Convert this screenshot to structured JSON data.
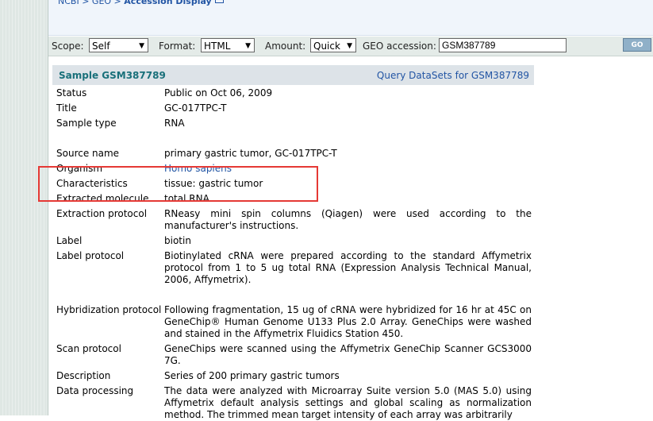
{
  "breadcrumb": {
    "part1": "NCBI",
    "sep1": " > ",
    "part2": "GEO",
    "sep2": " > ",
    "current": "Accession Display"
  },
  "toolbar": {
    "scope_label": "Scope:",
    "scope_value": "Self",
    "format_label": "Format:",
    "format_value": "HTML",
    "amount_label": "Amount:",
    "amount_value": "Quick",
    "accession_label": "GEO accession:",
    "accession_value": "GSM387789",
    "go_label": "GO"
  },
  "sample": {
    "title": "Sample GSM387789",
    "query_link": "Query DataSets for GSM387789"
  },
  "fields": {
    "status": {
      "label": "Status",
      "value": "Public on Oct 06, 2009"
    },
    "title": {
      "label": "Title",
      "value": "GC-017TPC-T"
    },
    "sample_type": {
      "label": "Sample type",
      "value": "RNA"
    },
    "source_name": {
      "label": "Source name",
      "value": "primary gastric tumor, GC-017TPC-T"
    },
    "organism": {
      "label": "Organism",
      "value": "Homo sapiens"
    },
    "characteristics": {
      "label": "Characteristics",
      "value": "tissue: gastric tumor"
    },
    "extracted_molecule": {
      "label": "Extracted molecule",
      "value": "total RNA"
    },
    "extraction_protocol": {
      "label": "Extraction protocol",
      "value": "RNeasy mini spin columns (Qiagen) were used according to the manufacturer's instructions."
    },
    "label": {
      "label": "Label",
      "value": "biotin"
    },
    "label_protocol": {
      "label": "Label protocol",
      "value": "Biotinylated cRNA were prepared according to the standard Affymetrix protocol from 1 to 5 ug total RNA (Expression Analysis Technical Manual, 2006, Affymetrix)."
    },
    "hybridization_protocol": {
      "label": "Hybridization protocol",
      "value": "Following fragmentation, 15 ug of cRNA were hybridized for 16 hr at 45C on GeneChip® Human Genome U133 Plus 2.0 Array. GeneChips were washed and stained in the Affymetrix Fluidics Station 450."
    },
    "scan_protocol": {
      "label": "Scan protocol",
      "value": "GeneChips were scanned using the Affymetrix GeneChip Scanner GCS3000 7G."
    },
    "description": {
      "label": "Description",
      "value": "Series of 200 primary gastric tumors"
    },
    "data_processing": {
      "label": "Data processing",
      "value": "The data were analyzed with Microarray Suite version 5.0 (MAS 5.0) using Affymetrix default analysis settings and global scaling as normalization method. The trimmed mean target intensity of each array was arbitrarily"
    }
  },
  "colors": {
    "title_teal": "#19707a",
    "link_blue": "#2255a4",
    "highlight_red": "#e53935"
  }
}
